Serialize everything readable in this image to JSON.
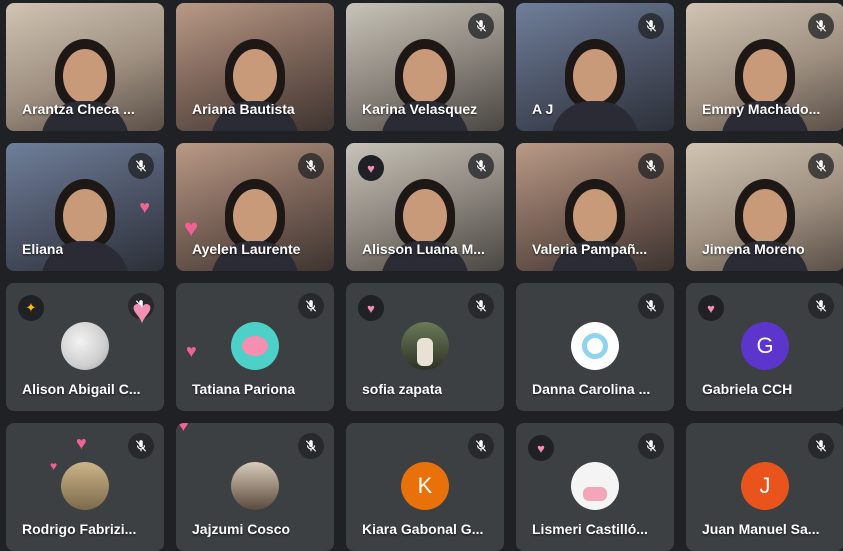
{
  "colors": {
    "tile_bg": "#3c4043",
    "page_bg": "#202124",
    "accent_heart": "#f06292"
  },
  "participants": [
    {
      "name": "Arantza Checa ...",
      "video": true,
      "muted": false
    },
    {
      "name": "Ariana Bautista",
      "video": true,
      "muted": false
    },
    {
      "name": "Karina Velasquez",
      "video": true,
      "muted": true
    },
    {
      "name": "A J",
      "video": true,
      "muted": true
    },
    {
      "name": "Emmy Machado...",
      "video": true,
      "muted": true
    },
    {
      "name": "Eliana",
      "video": true,
      "muted": true
    },
    {
      "name": "Ayelen Laurente",
      "video": true,
      "muted": true
    },
    {
      "name": "Alisson Luana M...",
      "video": true,
      "muted": true
    },
    {
      "name": "Valeria Pampañ...",
      "video": true,
      "muted": true
    },
    {
      "name": "Jimena Moreno",
      "video": true,
      "muted": true
    },
    {
      "name": "Alison Abigail C...",
      "video": false,
      "muted": true,
      "avatar_icon": "profile-photo",
      "reaction": "party-popper-icon"
    },
    {
      "name": "Tatiana Pariona",
      "video": false,
      "muted": true,
      "avatar_icon": "profile-photo"
    },
    {
      "name": "sofia zapata",
      "video": false,
      "muted": true,
      "avatar_icon": "profile-photo",
      "reaction": "heart-icon"
    },
    {
      "name": "Danna Carolina ...",
      "video": false,
      "muted": true,
      "avatar_icon": "profile-photo"
    },
    {
      "name": "Gabriela CCH",
      "video": false,
      "muted": true,
      "avatar_letter": "G",
      "avatar_color": "#5c35cc",
      "reaction": "heart-icon"
    },
    {
      "name": "Rodrigo Fabrizi...",
      "video": false,
      "muted": true,
      "avatar_icon": "profile-photo"
    },
    {
      "name": "Jajzumi Cosco",
      "video": false,
      "muted": true,
      "avatar_icon": "profile-photo"
    },
    {
      "name": "Kiara Gabonal G...",
      "video": false,
      "muted": true,
      "avatar_letter": "K",
      "avatar_color": "#e8710a"
    },
    {
      "name": "Lismeri Castilló...",
      "video": false,
      "muted": true,
      "avatar_icon": "profile-photo",
      "reaction": "heart-icon"
    },
    {
      "name": "Juan Manuel Sa...",
      "video": false,
      "muted": true,
      "avatar_letter": "J",
      "avatar_color": "#e8541c"
    }
  ],
  "icons": {
    "mute": "mic-off-icon",
    "reaction_heart": "heart-icon"
  }
}
